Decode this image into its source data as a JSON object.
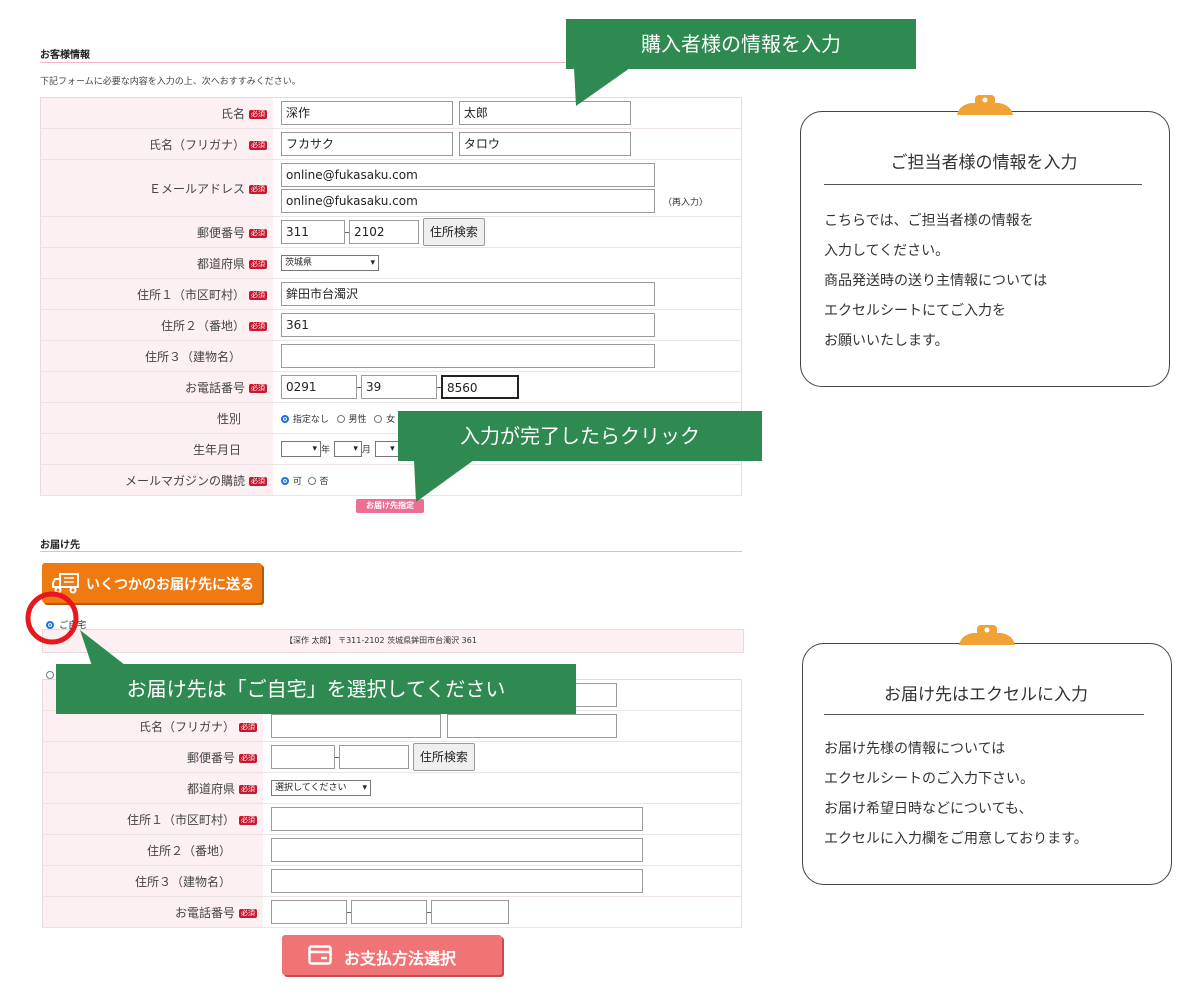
{
  "customer": {
    "title": "お客様情報",
    "intro": "下記フォームに必要な内容を入力の上、次へおすすみください。",
    "required": "必須",
    "labels": {
      "name": "氏名",
      "kana": "氏名（フリガナ）",
      "email": "Ｅメールアドレス",
      "zip": "郵便番号",
      "pref": "都道府県",
      "addr1": "住所１（市区町村）",
      "addr2": "住所２（番地）",
      "addr3": "住所３（建物名）",
      "tel": "お電話番号",
      "gender": "性別",
      "birth": "生年月日",
      "magazine": "メールマガジンの購読"
    },
    "values": {
      "last_name": "深作",
      "first_name": "太郎",
      "last_kana": "フカサク",
      "first_kana": "タロウ",
      "email": "online@fukasaku.com",
      "email_confirm": "online@fukasaku.com",
      "email_confirm_note": "（再入力）",
      "zip1": "311",
      "zip2": "2102",
      "zip_search": "住所検索",
      "pref": "茨城県",
      "addr1": "鉾田市台濁沢",
      "addr2": "361",
      "addr3": "",
      "tel1": "0291",
      "tel2": "39",
      "tel3": "8560"
    },
    "gender_options": [
      "指定なし",
      "男性",
      "女"
    ],
    "birth_units": [
      "年",
      "月"
    ],
    "magazine_options": [
      "可",
      "否"
    ],
    "next_button": "お届け先指定"
  },
  "delivery": {
    "title": "お届け先",
    "multi_button": "いくつかのお届け先に送る",
    "home_option": "ご自宅",
    "home_address": "【深作 太郎】 〒311-2102 茨城県鉾田市台濁沢 361",
    "required": "必須",
    "labels": {
      "kana": "氏名（フリガナ）",
      "zip": "郵便番号",
      "pref": "都道府県",
      "addr1": "住所１（市区町村）",
      "addr2": "住所２（番地）",
      "addr3": "住所３（建物名）",
      "tel": "お電話番号"
    },
    "zip_search": "住所検索",
    "pref_placeholder": "選択してください",
    "pay_button": "お支払方法選択"
  },
  "callouts": {
    "buyer": "購入者様の情報を入力",
    "click": "入力が完了したらクリック",
    "home": "お届け先は「ご自宅」を選択してください"
  },
  "cards": {
    "staff": {
      "title": "ご担当者様の情報を入力",
      "lines": [
        "こちらでは、ご担当者様の情報を",
        "入力してください。",
        "商品発送時の送り主情報については",
        "エクセルシートにてご入力を",
        "お願いいたします。"
      ]
    },
    "excel": {
      "title": "お届け先はエクセルに入力",
      "lines": [
        "お届け先様の情報については",
        "エクセルシートのご入力下さい。",
        "お届け希望日時などについても、",
        "エクセルに入力欄をご用意しております。"
      ]
    }
  },
  "colors": {
    "callout": "#2f8a52",
    "required_badge": "#c8172e",
    "label_bg": "#fdf0f3",
    "orange_button": "#f07a12",
    "pay_button": "#f07375",
    "highlight_circle": "#e8171e",
    "clip": "#f0a236"
  }
}
